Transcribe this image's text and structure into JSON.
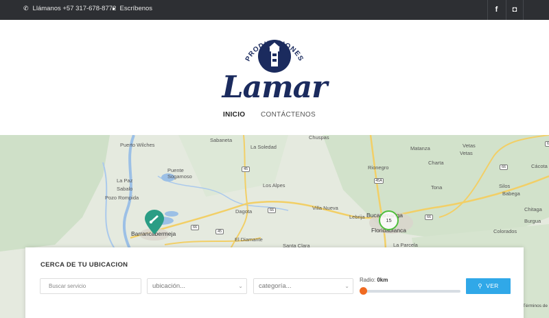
{
  "topbar": {
    "phone_icon": "phone-icon",
    "phone": "Llámanos +57 317-678-8772",
    "mail_icon": "caret-right-icon",
    "mail": "Escríbenos",
    "facebook": "f",
    "instagram": "◘"
  },
  "logo": {
    "producciones": "PRODUCCIONES",
    "name": "Lamar"
  },
  "nav": {
    "items": [
      "INICIO",
      "CONTÁCTENOS"
    ]
  },
  "map": {
    "places": [
      "Puerto Wilches",
      "Sabaneta",
      "La Soledad",
      "Chuspas",
      "Matanza",
      "Vetas",
      "Vetas",
      "Cácota",
      "Puente Sogamoso",
      "La Paz",
      "Sabalo",
      "Pozo Rompida",
      "Los Alpes",
      "Rionegro",
      "Charta",
      "Tona",
      "Silos",
      "Babega",
      "Dagota",
      "Villa Nueva",
      "Lebrija",
      "Bucaramanga",
      "Floridablanca",
      "Chitaga",
      "Burgua",
      "Colorados",
      "Barrancabermeja",
      "El Diamante",
      "Santa Clara",
      "La Parcela"
    ],
    "shields": [
      "45",
      "45A",
      "66",
      "66",
      "66",
      "45",
      "66",
      "66"
    ],
    "cluster_count": "15",
    "terms": "Términos de"
  },
  "search": {
    "title": "CERCA DE TU UBICACION",
    "placeholder": "Buscar servicio",
    "location_value": "ubicación...",
    "category_value": "categoría...",
    "radius_label": "Radio:",
    "radius_value": "0km",
    "radius_level": 0,
    "button": "VER"
  },
  "colors": {
    "topbar": "#2d2f33",
    "brand": "#1b2b5e",
    "accent_button": "#30a8e8",
    "slider_knob": "#f06a21",
    "pin": "#2a9d85",
    "cluster": "#4fbf3c"
  }
}
